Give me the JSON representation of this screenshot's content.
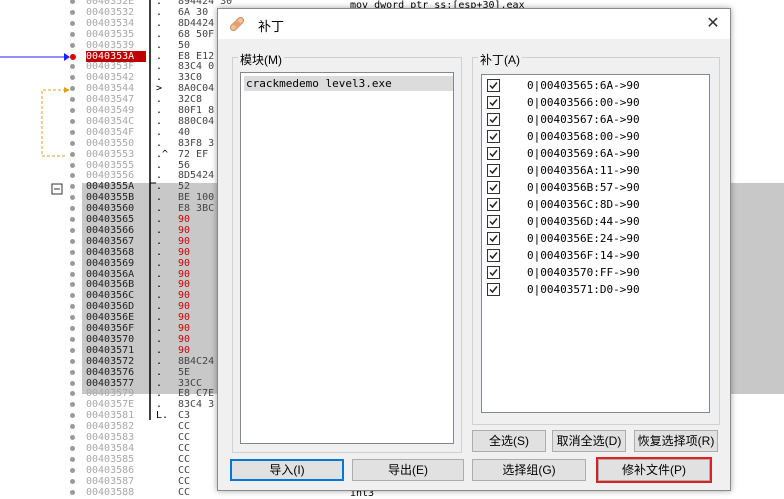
{
  "disasm": {
    "rows": [
      {
        "addr": "0040352E",
        "mark": ".",
        "bytes": "894424 30"
      },
      {
        "addr": "00403532",
        "mark": ".",
        "bytes": "6A 30"
      },
      {
        "addr": "00403534",
        "mark": ".",
        "bytes": "8D4424"
      },
      {
        "addr": "00403535",
        "mark": ".",
        "bytes": "68 50F"
      },
      {
        "addr": "00403539",
        "mark": ".",
        "bytes": "50"
      },
      {
        "addr": "0040353A",
        "mark": ".",
        "bytes": "E8 E12"
      },
      {
        "addr": "0040353F",
        "mark": ".",
        "bytes": "83C4 0"
      },
      {
        "addr": "00403542",
        "mark": ".",
        "bytes": "33C0"
      },
      {
        "addr": "00403544",
        "mark": ">",
        "bytes": "8A0C04"
      },
      {
        "addr": "00403547",
        "mark": ".",
        "bytes": "32C8"
      },
      {
        "addr": "00403549",
        "mark": ".",
        "bytes": "80F1 8"
      },
      {
        "addr": "0040354C",
        "mark": ".",
        "bytes": "880C04"
      },
      {
        "addr": "0040354F",
        "mark": ".",
        "bytes": "40"
      },
      {
        "addr": "00403550",
        "mark": ".",
        "bytes": "83F8 3"
      },
      {
        "addr": "00403553",
        "mark": ".^",
        "bytes": "72 EF"
      },
      {
        "addr": "00403555",
        "mark": ".",
        "bytes": "56"
      },
      {
        "addr": "00403556",
        "mark": ".",
        "bytes": "8D5424"
      },
      {
        "addr": "0040355A",
        "mark": ".",
        "bytes": "52"
      },
      {
        "addr": "0040355B",
        "mark": ".",
        "bytes": "BE 100"
      },
      {
        "addr": "00403560",
        "mark": ".",
        "bytes": "E8 3BC"
      },
      {
        "addr": "00403565",
        "mark": ".",
        "bytes": "90"
      },
      {
        "addr": "00403566",
        "mark": ".",
        "bytes": "90"
      },
      {
        "addr": "00403567",
        "mark": ".",
        "bytes": "90"
      },
      {
        "addr": "00403568",
        "mark": ".",
        "bytes": "90"
      },
      {
        "addr": "00403569",
        "mark": ".",
        "bytes": "90"
      },
      {
        "addr": "0040356A",
        "mark": ".",
        "bytes": "90"
      },
      {
        "addr": "0040356B",
        "mark": ".",
        "bytes": "90"
      },
      {
        "addr": "0040356C",
        "mark": ".",
        "bytes": "90"
      },
      {
        "addr": "0040356D",
        "mark": ".",
        "bytes": "90"
      },
      {
        "addr": "0040356E",
        "mark": ".",
        "bytes": "90"
      },
      {
        "addr": "0040356F",
        "mark": ".",
        "bytes": "90"
      },
      {
        "addr": "00403570",
        "mark": ".",
        "bytes": "90"
      },
      {
        "addr": "00403571",
        "mark": ".",
        "bytes": "90"
      },
      {
        "addr": "00403572",
        "mark": ".",
        "bytes": "8B4C24"
      },
      {
        "addr": "00403576",
        "mark": ".",
        "bytes": "5E"
      },
      {
        "addr": "00403577",
        "mark": ".",
        "bytes": "33CC"
      },
      {
        "addr": "00403579",
        "mark": ".",
        "bytes": "E8 C7E"
      },
      {
        "addr": "0040357E",
        "mark": ".",
        "bytes": "83C4 3"
      },
      {
        "addr": "00403581",
        "mark": "L.",
        "bytes": "C3"
      },
      {
        "addr": "00403582",
        "mark": "",
        "bytes": "CC"
      },
      {
        "addr": "00403583",
        "mark": "",
        "bytes": "CC"
      },
      {
        "addr": "00403584",
        "mark": "",
        "bytes": "CC"
      },
      {
        "addr": "00403585",
        "mark": "",
        "bytes": "CC"
      },
      {
        "addr": "00403586",
        "mark": "",
        "bytes": "CC"
      },
      {
        "addr": "00403587",
        "mark": "",
        "bytes": "CC"
      },
      {
        "addr": "00403588",
        "mark": "",
        "bytes": "CC"
      }
    ],
    "asm_top": "mov dword ptr ss:[esp+30],eax",
    "asm_bottom": "int3"
  },
  "dialog": {
    "title": "补丁",
    "close_label": "✕",
    "modules_label": "模块(M)",
    "patches_label": "补丁(A)",
    "modules": [
      "crackmedemo level3.exe"
    ],
    "patches": [
      "0|00403565:6A->90",
      "0|00403566:00->90",
      "0|00403567:6A->90",
      "0|00403568:00->90",
      "0|00403569:6A->90",
      "0|0040356A:11->90",
      "0|0040356B:57->90",
      "0|0040356C:8D->90",
      "0|0040356D:44->90",
      "0|0040356E:24->90",
      "0|0040356F:14->90",
      "0|00403570:FF->90",
      "0|00403571:D0->90"
    ],
    "buttons": {
      "select_all": "全选(S)",
      "deselect_all": "取消全选(D)",
      "restore": "恢复选择项(R)",
      "import": "导入(I)",
      "export": "导出(E)",
      "select_group": "选择组(G)",
      "patch_file": "修补文件(P)"
    }
  }
}
